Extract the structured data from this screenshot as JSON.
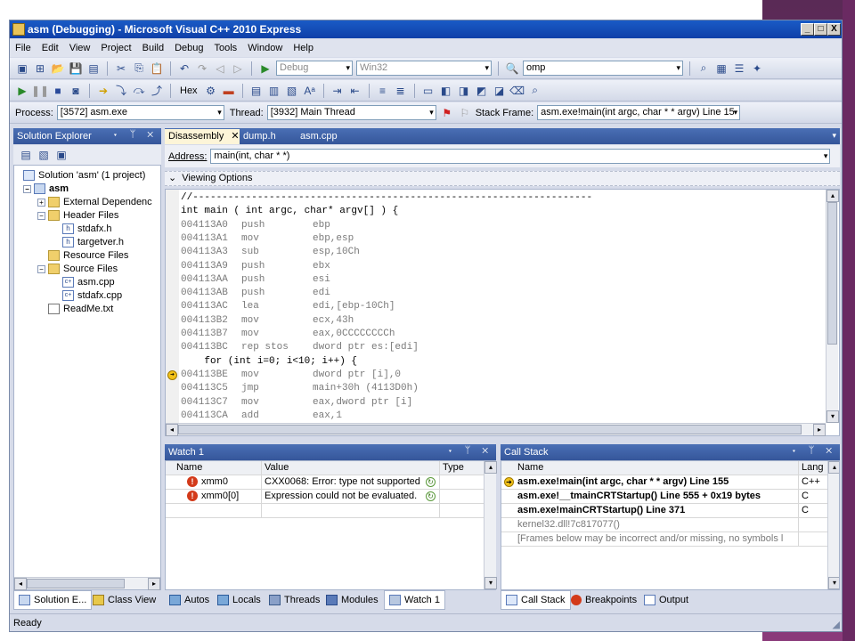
{
  "window": {
    "title": "asm (Debugging) - Microsoft Visual C++ 2010 Express",
    "buttons": [
      "_",
      "□",
      "X"
    ]
  },
  "menu": [
    "File",
    "Edit",
    "View",
    "Project",
    "Build",
    "Debug",
    "Tools",
    "Window",
    "Help"
  ],
  "toolbar1": {
    "config": "Debug",
    "platform": "Win32",
    "find": "omp"
  },
  "toolbar2": {
    "hex_label": "Hex"
  },
  "debug_location": {
    "process_label": "Process:",
    "process": "[3572] asm.exe",
    "thread_label": "Thread:",
    "thread": "[3932] Main Thread",
    "stackframe_label": "Stack Frame:",
    "stackframe": "asm.exe!main(int argc, char * * argv)  Line 15"
  },
  "solution_explorer": {
    "title": "Solution Explorer",
    "items": [
      {
        "label": "Solution 'asm' (1 project)"
      },
      {
        "label": "asm"
      },
      {
        "label": "External Dependenc"
      },
      {
        "label": "Header Files"
      },
      {
        "label": "stdafx.h"
      },
      {
        "label": "targetver.h"
      },
      {
        "label": "Resource Files"
      },
      {
        "label": "Source Files"
      },
      {
        "label": "asm.cpp"
      },
      {
        "label": "stdafx.cpp"
      },
      {
        "label": "ReadMe.txt"
      }
    ]
  },
  "editor": {
    "tabs": [
      {
        "label": "Disassembly",
        "active": true
      },
      {
        "label": "dump.h",
        "active": false
      },
      {
        "label": "asm.cpp",
        "active": false
      }
    ],
    "address_label": "Address:",
    "address": "main(int, char * *)",
    "viewing_options": "Viewing Options",
    "lines": [
      {
        "text": "//--------------------------------------------------------------------"
      },
      {
        "text": "int main ( int argc, char* argv[] ) {"
      },
      {
        "addr": "004113A0",
        "mn": "push",
        "op": "ebp"
      },
      {
        "addr": "004113A1",
        "mn": "mov",
        "op": "ebp,esp"
      },
      {
        "addr": "004113A3",
        "mn": "sub",
        "op": "esp,10Ch"
      },
      {
        "addr": "004113A9",
        "mn": "push",
        "op": "ebx"
      },
      {
        "addr": "004113AA",
        "mn": "push",
        "op": "esi"
      },
      {
        "addr": "004113AB",
        "mn": "push",
        "op": "edi"
      },
      {
        "addr": "004113AC",
        "mn": "lea",
        "op": "edi,[ebp-10Ch]"
      },
      {
        "addr": "004113B2",
        "mn": "mov",
        "op": "ecx,43h"
      },
      {
        "addr": "004113B7",
        "mn": "mov",
        "op": "eax,0CCCCCCCCh"
      },
      {
        "addr": "004113BC",
        "mn": "rep stos",
        "op": "dword ptr es:[edi]"
      },
      {
        "text": "    for (int i=0; i<10; i++) {"
      },
      {
        "addr": "004113BE",
        "mn": "mov",
        "op": "dword ptr [i],0",
        "current": true
      },
      {
        "addr": "004113C5",
        "mn": "jmp",
        "op": "main+30h (4113D0h)"
      },
      {
        "addr": "004113C7",
        "mn": "mov",
        "op": "eax,dword ptr [i]"
      },
      {
        "addr": "004113CA",
        "mn": "add",
        "op": "eax,1"
      }
    ]
  },
  "watch": {
    "title": "Watch 1",
    "columns": [
      "Name",
      "Value",
      "Type"
    ],
    "rows": [
      {
        "name": "xmm0",
        "value": "CXX0068: Error: type not supported"
      },
      {
        "name": "xmm0[0]",
        "value": "Expression could not be evaluated."
      }
    ]
  },
  "callstack": {
    "title": "Call Stack",
    "columns": [
      "Name",
      "Lang"
    ],
    "rows": [
      {
        "name": "asm.exe!main(int argc, char * * argv)  Line 155",
        "lang": "C++",
        "bold": true
      },
      {
        "name": "asm.exe!__tmainCRTStartup()  Line 555 + 0x19 bytes",
        "lang": "C",
        "bold": true
      },
      {
        "name": "asm.exe!mainCRTStartup()  Line 371",
        "lang": "C",
        "bold": true
      },
      {
        "name": "kernel32.dll!7c817077()",
        "lang": "",
        "bold": false
      },
      {
        "name": "[Frames below may be incorrect and/or missing, no symbols l",
        "lang": "",
        "bold": false
      }
    ]
  },
  "bottom_tabs_left": [
    "Solution E...",
    "Class View"
  ],
  "bottom_tabs_mid": [
    "Autos",
    "Locals",
    "Threads",
    "Modules",
    "Watch 1"
  ],
  "bottom_tabs_right": [
    "Call Stack",
    "Breakpoints",
    "Output"
  ],
  "status": "Ready",
  "colors": {
    "panel_header": "#3f62a8",
    "titlebar": "#1a5bc6",
    "error": "#d33a1a",
    "current_line_arrow": "#f2c21a"
  }
}
